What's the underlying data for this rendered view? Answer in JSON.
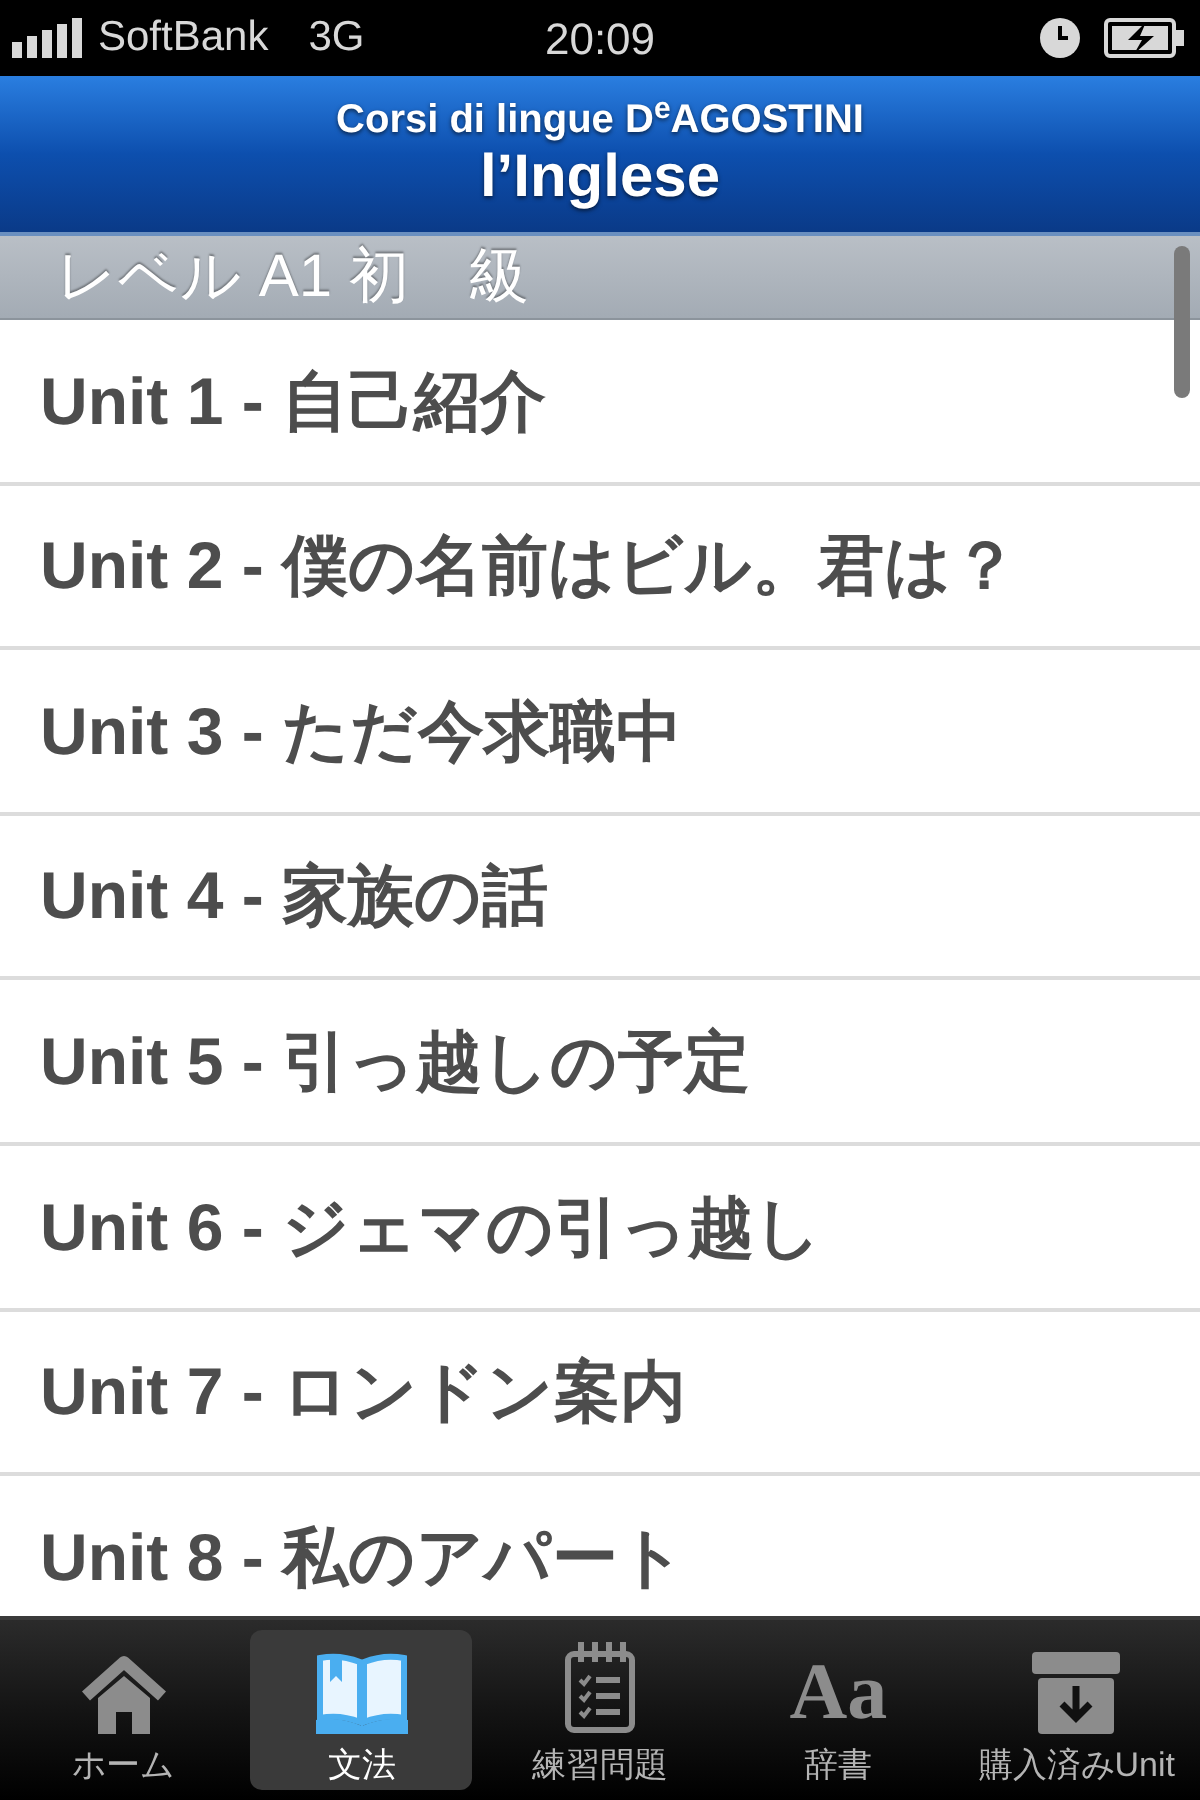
{
  "status_bar": {
    "carrier": "SoftBank",
    "network": "3G",
    "time": "20:09"
  },
  "header": {
    "brand_line": "Corsi di lingue D$^{e}$AGOSTINI",
    "title": "l’Inglese"
  },
  "section": {
    "title": "レベル A1 初　級"
  },
  "units": [
    "Unit 1 - 自己紹介",
    "Unit 2 - 僕の名前はビル。君は？",
    "Unit 3 - ただ今求職中",
    "Unit 4 - 家族の話",
    "Unit 5 - 引っ越しの予定",
    "Unit 6 - ジェマの引っ越し",
    "Unit 7 - ロンドン案内",
    "Unit 8 - 私のアパート"
  ],
  "tab_bar": [
    {
      "label": "ホーム",
      "kind": "home",
      "selected": false
    },
    {
      "label": "文法",
      "kind": "book",
      "selected": true
    },
    {
      "label": "練習問題",
      "kind": "notepad",
      "selected": false
    },
    {
      "label": "辞書",
      "kind": "letters",
      "glyph": "Aa",
      "selected": false
    },
    {
      "label": "購入済みUnit",
      "kind": "archive",
      "selected": false
    }
  ]
}
